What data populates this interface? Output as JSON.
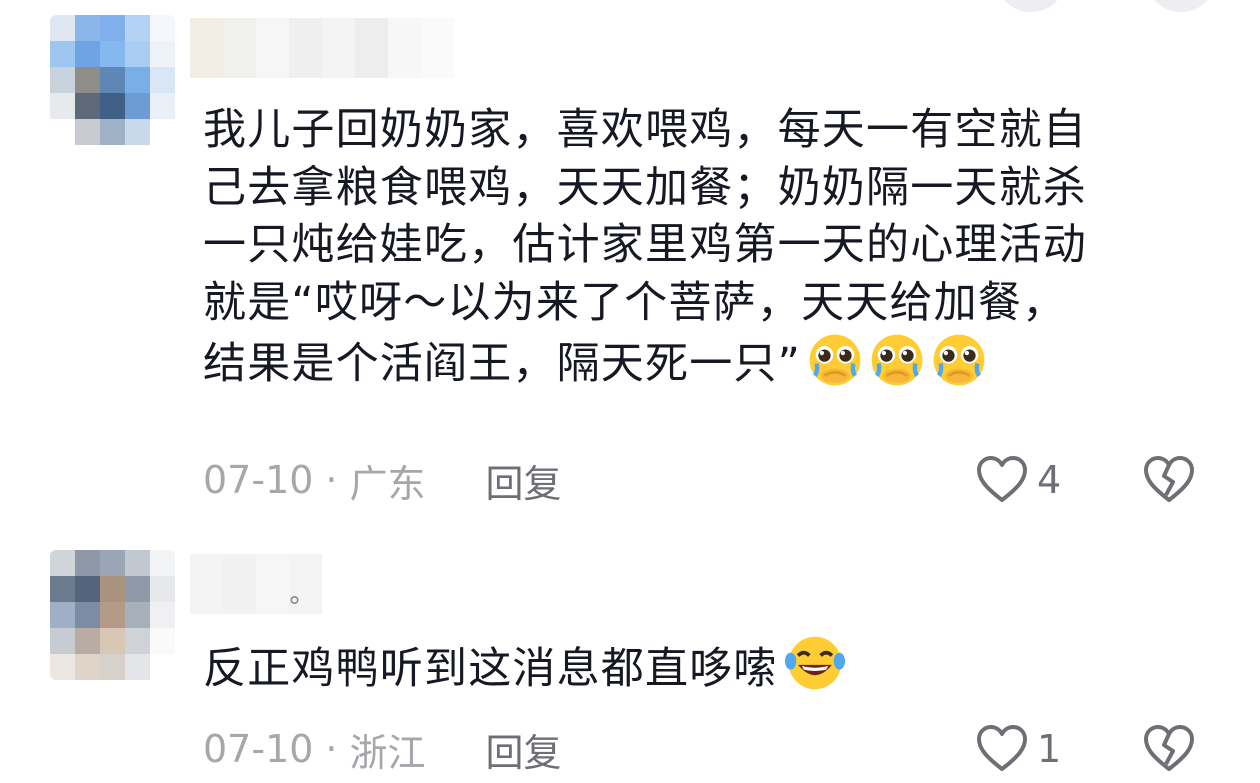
{
  "comments": [
    {
      "text": "我儿子回奶奶家，喜欢喂鸡，每天一有空就自\n己去拿粮食喂鸡，天天加餐；奶奶隔一天就杀\n一只炖给娃吃，估计家里鸡第一天的心理活动\n就是“哎呀～以为来了个菩萨，天天给加餐，\n结果是个活阎王，隔天死一只”",
      "emoji_name": "pleading-crying-face-icon",
      "emoji_count": 3,
      "date": "07-10",
      "separator": "·",
      "location": "广东",
      "reply_label": "回复",
      "like_count": "4"
    },
    {
      "text": "反正鸡鸭听到这消息都直哆嗦",
      "emoji_name": "laughing-tears-icon",
      "emoji_count": 1,
      "date": "07-10",
      "separator": "·",
      "location": "浙江",
      "reply_label": "回复",
      "like_count": "1"
    }
  ],
  "colors": {
    "text": "#161823",
    "meta": "#a6a7ab",
    "icon": "#6e6f75",
    "emoji_yellow": "#ffcc33"
  }
}
